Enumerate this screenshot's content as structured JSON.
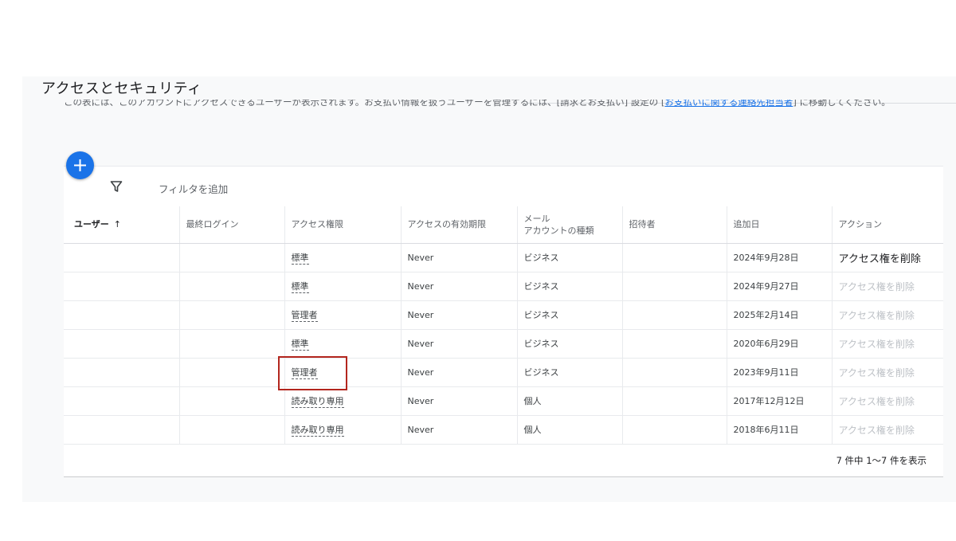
{
  "page": {
    "title": "アクセスとセキュリティ",
    "description_prefix": "この表には、このアカウントにアクセスできるユーザーが表示されます。お支払い情報を扱うユーザーを管理するには、[請求とお支払い] 設定の [",
    "description_link": "お支払いに関する連絡先担当者",
    "description_suffix": "] に移動してください。"
  },
  "toolbar": {
    "add_button_icon": "plus-icon",
    "filter_icon": "filter-icon",
    "filter_label": "フィルタを追加"
  },
  "table": {
    "headers": {
      "user": "ユーザー",
      "last_login": "最終ログイン",
      "access_role": "アクセス権限",
      "expiry": "アクセスの有効期限",
      "email_type_line1": "メール",
      "email_type_line2": "アカウントの種類",
      "inviter": "招待者",
      "added": "追加日",
      "action": "アクション"
    },
    "sort_icon": "arrow-up-icon",
    "rows": [
      {
        "user": "",
        "last_login": "",
        "role": "標準",
        "expiry": "Never",
        "account_type": "ビジネス",
        "inviter": "",
        "added": "2024年9月28日",
        "action": "アクセス権を削除",
        "action_enabled": true
      },
      {
        "user": "",
        "last_login": "",
        "role": "標準",
        "expiry": "Never",
        "account_type": "ビジネス",
        "inviter": "",
        "added": "2024年9月27日",
        "action": "アクセス権を削除",
        "action_enabled": false
      },
      {
        "user": "",
        "last_login": "",
        "role": "管理者",
        "expiry": "Never",
        "account_type": "ビジネス",
        "inviter": "",
        "added": "2025年2月14日",
        "action": "アクセス権を削除",
        "action_enabled": false
      },
      {
        "user": "",
        "last_login": "",
        "role": "標準",
        "expiry": "Never",
        "account_type": "ビジネス",
        "inviter": "",
        "added": "2020年6月29日",
        "action": "アクセス権を削除",
        "action_enabled": false
      },
      {
        "user": "",
        "last_login": "",
        "role": "管理者",
        "expiry": "Never",
        "account_type": "ビジネス",
        "inviter": "",
        "added": "2023年9月11日",
        "action": "アクセス権を削除",
        "action_enabled": false
      },
      {
        "user": "",
        "last_login": "",
        "role": "読み取り専用",
        "expiry": "Never",
        "account_type": "個人",
        "inviter": "",
        "added": "2017年12月12日",
        "action": "アクセス権を削除",
        "action_enabled": false
      },
      {
        "user": "",
        "last_login": "",
        "role": "読み取り専用",
        "expiry": "Never",
        "account_type": "個人",
        "inviter": "",
        "added": "2018年6月11日",
        "action": "アクセス権を削除",
        "action_enabled": false
      }
    ]
  },
  "pagination": {
    "text": "7 件中 1〜7 件を表示"
  },
  "colors": {
    "accent": "#1a73e8",
    "highlight_border": "#b3261e",
    "disabled_text": "#bdc1c6"
  }
}
